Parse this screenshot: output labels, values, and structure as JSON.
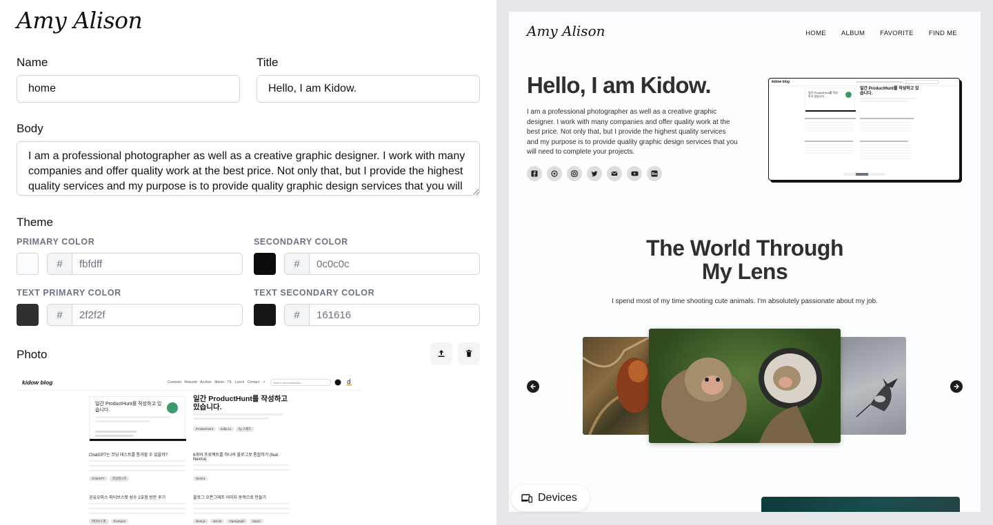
{
  "brand": "Amy Alison",
  "form": {
    "name_label": "Name",
    "name_value": "home",
    "title_label": "Title",
    "title_value": "Hello, I am Kidow.",
    "body_label": "Body",
    "body_value": "I am a professional photographer as well as a creative graphic designer. I work with many companies and offer quality work at the best price. Not only that, but I provide the highest quality services and my purpose is to provide quality graphic design services that you will need to complete your projects.",
    "theme_label": "Theme",
    "photo_label": "Photo"
  },
  "theme": {
    "primary_label": "PRIMARY COLOR",
    "primary_value": "fbfdff",
    "secondary_label": "SECONDARY COLOR",
    "secondary_value": "0c0c0c",
    "text_primary_label": "TEXT PRIMARY COLOR",
    "text_primary_value": "2f2f2f",
    "text_secondary_label": "TEXT SECONDARY COLOR",
    "text_secondary_value": "161616",
    "hash": "#"
  },
  "mini": {
    "logo": "kidow blog",
    "nav": "Contents Résumé Archive Memo TIL Lunch Contact ↗",
    "search": "Search documentation...",
    "card_title": "일간 ProductHunt를 작성하고 있습니다.",
    "title": "일간 ProductHunt를 작성하고 있습니다.",
    "tags": [
      "ProductHunt",
      "indly.co",
      "by 스레드"
    ],
    "post1": "ChatGPT는 코딩 테스트를 통과할 수 있을까?",
    "post2": "6개의 프로젝트를 하나의 블로그로 통합하기 (feat. Nextra)",
    "post3": "공유오피스 파이브스팟 성수 2호점 방문 후기",
    "post4": "블로그 오픈그래프 이미지 동적으로 만들기",
    "tags1": [
      "ChatGPT",
      "코딩테스트"
    ],
    "tags2": [
      "Nextra"
    ],
    "tags3": [
      "파이브스팟",
      "Fivespot"
    ],
    "tags4": [
      "Next.js",
      "Vercel",
      "Opengraph",
      "Satori"
    ]
  },
  "preview": {
    "nav": [
      "HOME",
      "ALBUM",
      "FAVORITE",
      "FIND ME"
    ],
    "hero_title": "Hello, I am Kidow.",
    "hero_body": "I am a professional photographer as well as a creative graphic designer. I work with many companies and offer quality work at the best price. Not only that, but I provide the highest quality services and my purpose is to provide quality graphic design services that you will need to complete your projects.",
    "section_title_1": "The World Through",
    "section_title_2": "My Lens",
    "section_sub": "I spend most of my time shooting cute animals. I'm absolutely passionate about my job.",
    "socials": [
      "facebook-icon",
      "whatsapp-icon",
      "instagram-icon",
      "twitter-icon",
      "mail-icon",
      "youtube-icon",
      "behance-icon"
    ]
  },
  "devices_label": "Devices",
  "colors": {
    "primary": "#fbfdff",
    "secondary": "#0c0c0c",
    "text_primary": "#2f2f2f",
    "text_secondary": "#161616"
  }
}
